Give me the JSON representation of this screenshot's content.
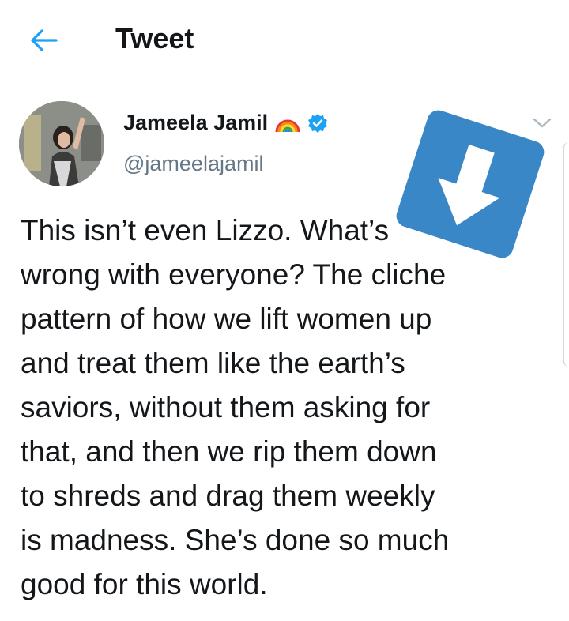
{
  "header": {
    "title": "Tweet",
    "back_icon": "arrow-left-icon",
    "accent_color": "#1da1f2"
  },
  "tweet": {
    "author": {
      "name": "Jameela Jamil",
      "handle": "@jameelajamil",
      "badges": [
        "rainbow-emoji",
        "verified-badge-icon"
      ]
    },
    "text": "This isn’t even Lizzo. What’s\nwrong with everyone? The cliche\npattern of how we lift women up\nand treat them like the earth’s\nsaviors, without them asking for\nthat, and then we rip them down\nto shreds and drag them weekly\nis madness. She’s done so much\ngood for this world.",
    "menu_icon": "chevron-down-icon"
  },
  "overlay": {
    "icon": "download-arrow-icon",
    "color": "#3a87c8"
  }
}
